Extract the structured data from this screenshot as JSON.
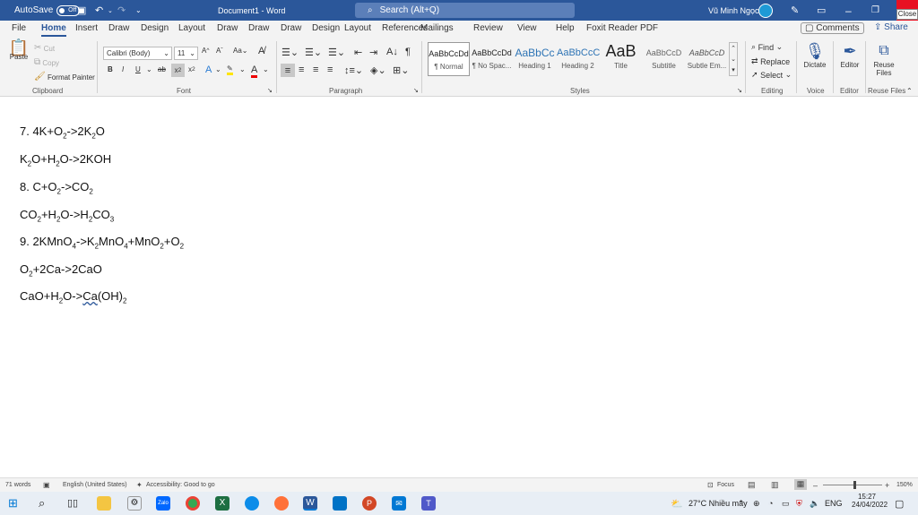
{
  "titlebar": {
    "autosave": "AutoSave",
    "autosave_state": "Off",
    "doc_title": "Document1 - Word",
    "search_placeholder": "Search (Alt+Q)",
    "user_name": "Vũ Minh Ngọc",
    "close_tooltip": "Close"
  },
  "tabs": [
    "File",
    "Home",
    "Insert",
    "Draw",
    "Design",
    "Layout",
    "Draw",
    "Draw",
    "Draw",
    "Design",
    "Layout",
    "References",
    "Mailings",
    "Review",
    "View",
    "Help",
    "Foxit Reader PDF"
  ],
  "comments_label": "Comments",
  "share_label": "Share",
  "clipboard": {
    "paste": "Paste",
    "cut": "Cut",
    "copy": "Copy",
    "format_painter": "Format Painter",
    "label": "Clipboard"
  },
  "font": {
    "name": "Calibri (Body)",
    "size": "11",
    "label": "Font"
  },
  "paragraph": {
    "label": "Paragraph"
  },
  "styles": {
    "label": "Styles",
    "items": [
      {
        "preview": "AaBbCcDd",
        "name": "¶ Normal"
      },
      {
        "preview": "AaBbCcDd",
        "name": "¶ No Spac..."
      },
      {
        "preview": "AaBbCc",
        "name": "Heading 1"
      },
      {
        "preview": "AaBbCcC",
        "name": "Heading 2"
      },
      {
        "preview": "AaB",
        "name": "Title"
      },
      {
        "preview": "AaBbCcD",
        "name": "Subtitle"
      },
      {
        "preview": "AaBbCcD",
        "name": "Subtle Em..."
      }
    ]
  },
  "editing": {
    "find": "Find",
    "replace": "Replace",
    "select": "Select",
    "label": "Editing"
  },
  "voice": {
    "dictate": "Dictate",
    "label": "Voice"
  },
  "editor": {
    "editor": "Editor",
    "label": "Editor"
  },
  "reuse": {
    "line1": "Reuse",
    "line2": "Files",
    "label": "Reuse Files"
  },
  "document": {
    "lines": [
      [
        "7. 4K+O",
        "2",
        "->2K",
        "2",
        "O"
      ],
      [
        "K",
        "2",
        "O+H",
        "2",
        "O->2KOH"
      ],
      [
        "8. C+O",
        "2",
        "->CO",
        "2",
        ""
      ],
      [
        "CO",
        "2",
        "+H",
        "2",
        "O->H",
        "2",
        "CO",
        "3",
        ""
      ],
      [
        "9. 2KMnO",
        "4",
        "->K",
        "2",
        "MnO",
        "4",
        "+MnO",
        "2",
        "+O",
        "2",
        ""
      ],
      [
        "O",
        "2",
        "+2Ca->2CaO"
      ],
      [
        "CaO+H",
        "2",
        "O->",
        "Ca",
        "(OH)",
        "2",
        ""
      ]
    ]
  },
  "status": {
    "words": "71 words",
    "language": "English (United States)",
    "accessibility": "Accessibility: Good to go",
    "focus": "Focus",
    "zoom": "150%"
  },
  "taskbar": {
    "weather": "27°C  Nhiều mây",
    "lang": "ENG",
    "time": "15:27",
    "date": "24/04/2022"
  }
}
